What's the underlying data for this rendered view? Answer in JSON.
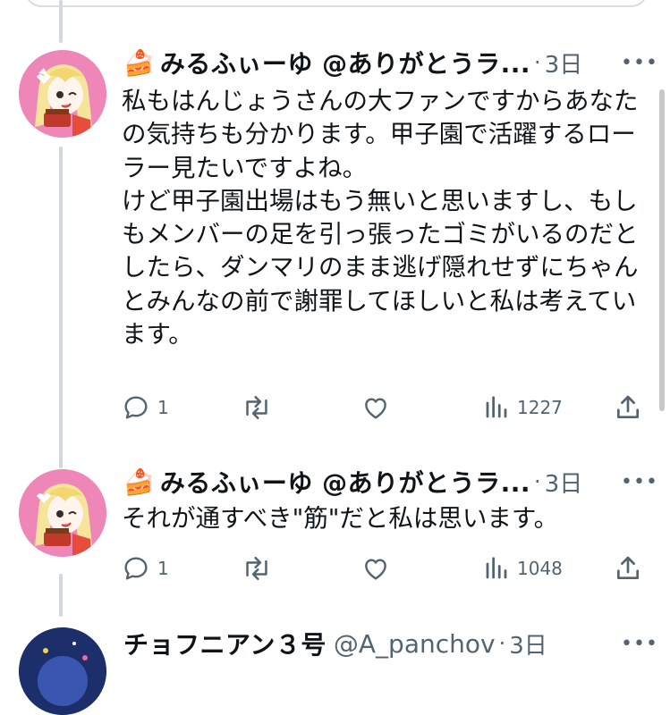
{
  "tweets": [
    {
      "name_icon": "cake-icon",
      "name_icon_char": "🍰",
      "name": "みるふぃーゆ @ありがとうラ...",
      "time": "3日",
      "text": "私もはんじょうさんの大ファンですからあなたの気持ちも分かります。甲子園で活躍するローラー見たいですよね。\nけど甲子園出場はもう無いと思いますし、もしもメンバーの足を引っ張ったゴミがいるのだとしたら、ダンマリのまま逃げ隠れせずにちゃんとみんなの前で謝罪してほしいと私は考えています。",
      "replies": "1",
      "views": "1227"
    },
    {
      "name_icon": "cake-icon",
      "name_icon_char": "🍰",
      "name": "みるふぃーゆ @ありがとうラ...",
      "time": "3日",
      "text": "それが通すべき\"筋\"だと私は思います。",
      "replies": "1",
      "views": "1048"
    },
    {
      "name": "チョフニアン３号",
      "handle": "@A_panchov",
      "time": "3日"
    }
  ],
  "separator": "·",
  "more_label": "•••",
  "colors": {
    "secondary_text": "#536471",
    "thread_line": "#cfd9de",
    "avatar_bg": "#ee86b8"
  }
}
